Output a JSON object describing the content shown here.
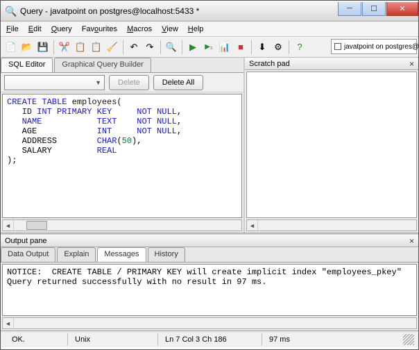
{
  "window": {
    "title": "Query - javatpoint on postgres@localhost:5433 *"
  },
  "menu": {
    "file": "File",
    "edit": "Edit",
    "query": "Query",
    "favourites": "Favourites",
    "macros": "Macros",
    "view": "View",
    "help": "Help"
  },
  "connection_box": "javatpoint on postgres@lo",
  "left": {
    "tab_sql": "SQL Editor",
    "tab_gqb": "Graphical Query Builder",
    "btn_delete": "Delete",
    "btn_delete_all": "Delete All"
  },
  "sql_tokens": {
    "l1a": "CREATE TABLE",
    "l1b": " employees(",
    "l2a": "   ID ",
    "l2b": "INT PRIMARY KEY",
    "l2c": "     ",
    "l2d": "NOT NULL",
    "l2e": ",",
    "l3a": "   ",
    "l3b": "NAME",
    "l3c": "           ",
    "l3d": "TEXT",
    "l3e": "    ",
    "l3f": "NOT NULL",
    "l3g": ",",
    "l4a": "   AGE            ",
    "l4b": "INT",
    "l4c": "     ",
    "l4d": "NOT NULL",
    "l4e": ",",
    "l5a": "   ADDRESS        ",
    "l5b": "CHAR",
    "l5c": "(",
    "l5d": "50",
    "l5e": "),",
    "l6a": "   SALARY         ",
    "l6b": "REAL",
    "l7": ");"
  },
  "scratch": {
    "title": "Scratch pad"
  },
  "output": {
    "title": "Output pane",
    "tab_data": "Data Output",
    "tab_explain": "Explain",
    "tab_messages": "Messages",
    "tab_history": "History",
    "msg_line1": "NOTICE:  CREATE TABLE / PRIMARY KEY will create implicit index \"employees_pkey\"",
    "msg_line2": "Query returned successfully with no result in 97 ms."
  },
  "status": {
    "ok": "OK.",
    "enc": "Unix",
    "pos": "Ln 7 Col 3 Ch 186",
    "time": "97 ms"
  }
}
